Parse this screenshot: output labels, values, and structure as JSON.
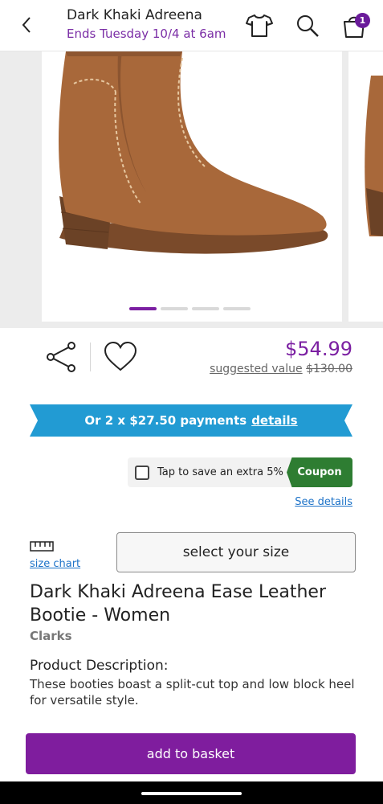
{
  "header": {
    "title": "Dark Khaki Adreena",
    "subtitle": "Ends Tuesday 10/4 at 6am",
    "cart_count": "1",
    "icons": [
      "back-arrow-icon",
      "tshirt-icon",
      "search-icon",
      "shopping-bag-icon"
    ]
  },
  "carousel": {
    "slide_count": 4,
    "active_index": 0
  },
  "price": {
    "current": "$54.99",
    "suggested_label": "suggested value",
    "suggested_value": "$130.00"
  },
  "payments": {
    "text": "Or 2 x $27.50 payments",
    "details_link": "details"
  },
  "coupon": {
    "text": "Tap to save an extra 5%",
    "tag": "Coupon",
    "see_details": "See details",
    "checked": false
  },
  "size": {
    "chart_link": "size chart",
    "select_label": "select your size"
  },
  "product": {
    "title": "Dark Khaki Adreena Ease Leather Bootie - Women",
    "brand": "Clarks",
    "description_heading": "Product Description:",
    "description": "These booties boast a split-cut top and low block heel for versatile style."
  },
  "actions": {
    "add_to_basket": "add to basket"
  },
  "colors": {
    "accent_purple": "#7f1d9e",
    "payment_blue": "#229bd3",
    "coupon_green": "#2e7d32",
    "link_blue": "#1e73c8"
  }
}
